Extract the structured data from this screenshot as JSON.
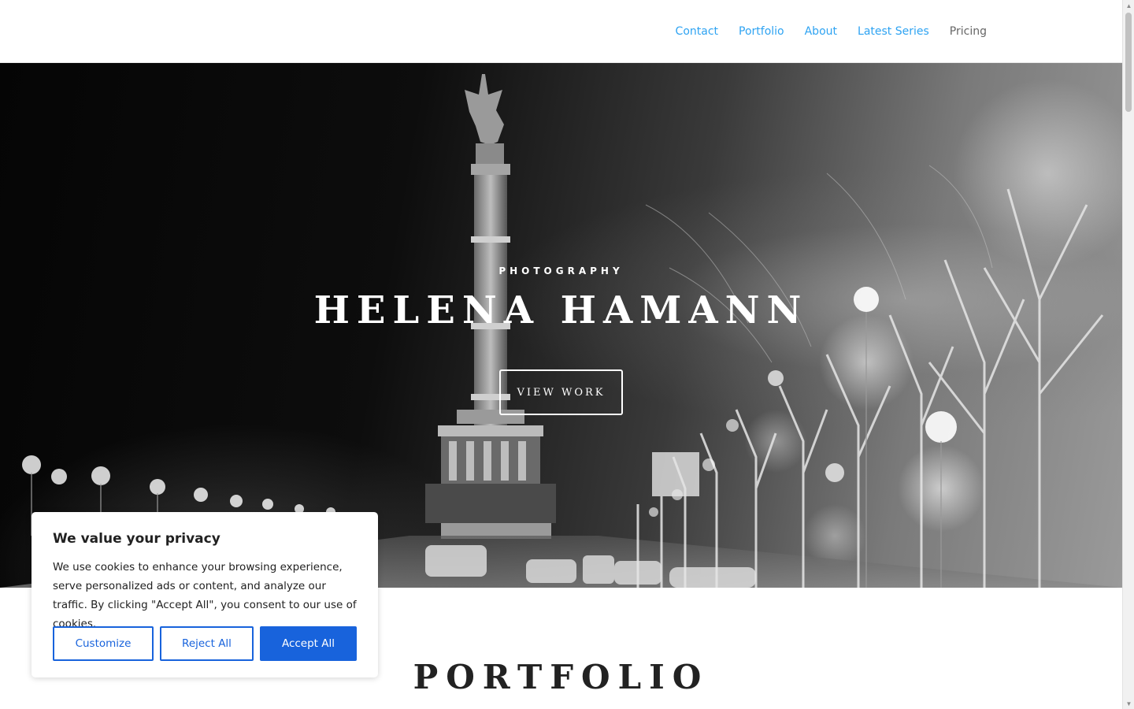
{
  "nav": {
    "items": [
      {
        "label": "Contact",
        "color": "#2ea3f2"
      },
      {
        "label": "Portfolio",
        "color": "#2ea3f2"
      },
      {
        "label": "About",
        "color": "#2ea3f2"
      },
      {
        "label": "Latest Series",
        "color": "#2ea3f2"
      },
      {
        "label": "Pricing",
        "color": "#666666"
      }
    ]
  },
  "hero": {
    "kicker": "PHOTOGRAPHY",
    "title": "HELENA HAMANN",
    "button_label": "VIEW WORK"
  },
  "portfolio": {
    "title": "PORTFOLIO"
  },
  "cookie": {
    "title": "We value your privacy",
    "text": "We use cookies to enhance your browsing experience, serve personalized ads or content, and analyze our traffic. By clicking \"Accept All\", you consent to our use of cookies.",
    "customize_label": "Customize",
    "reject_label": "Reject All",
    "accept_label": "Accept All",
    "accent_color": "#1863dc"
  },
  "icons": {
    "scroll_up": "scroll-up-arrow-icon",
    "scroll_down": "scroll-down-arrow-icon"
  }
}
